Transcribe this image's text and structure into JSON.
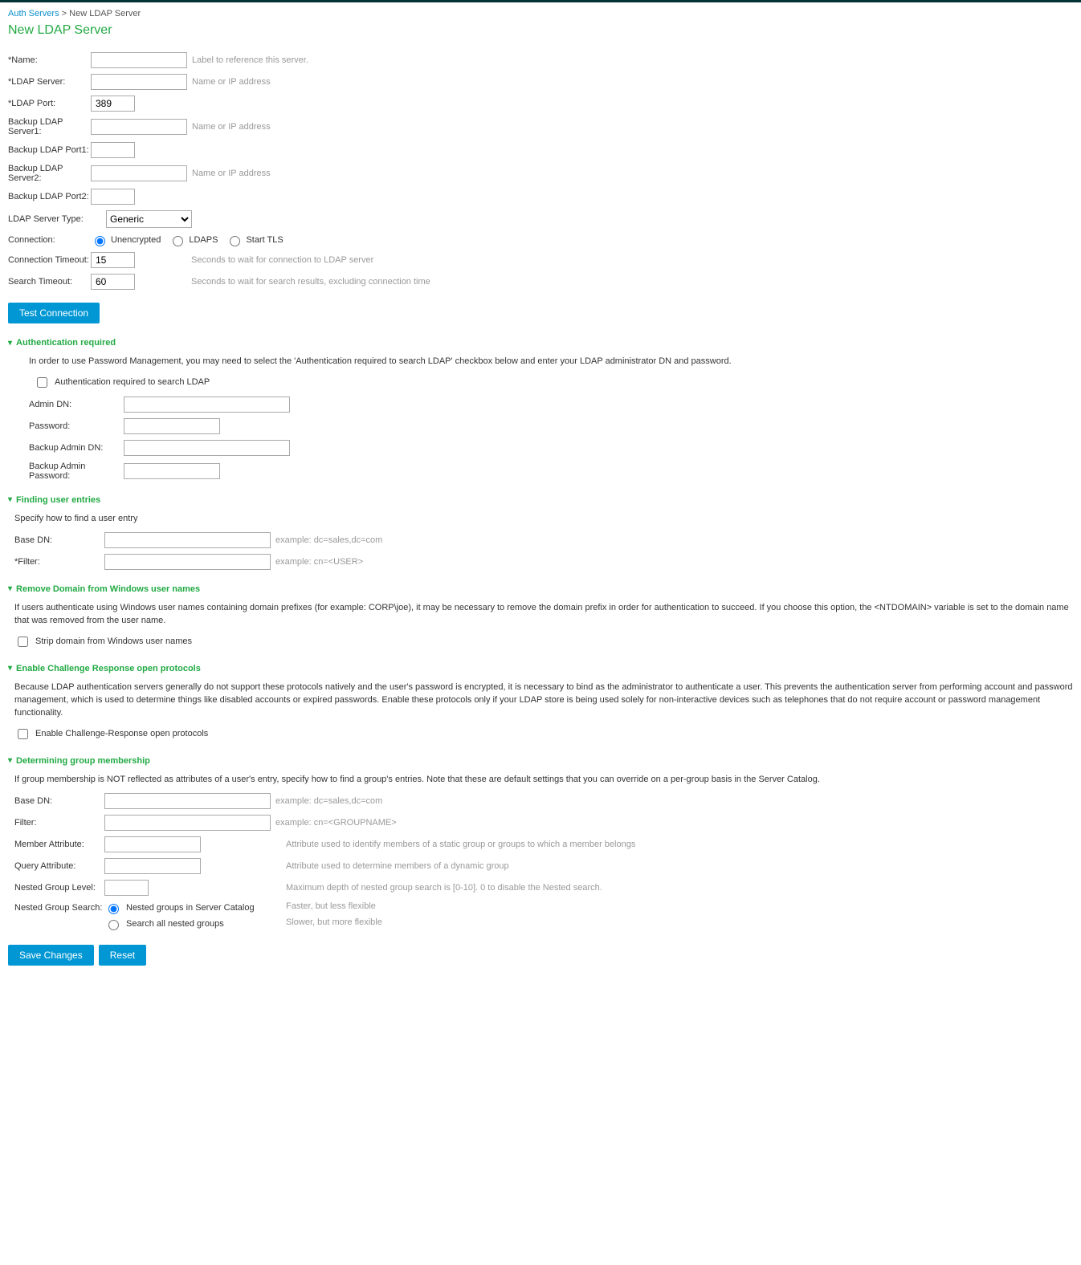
{
  "breadcrumb": {
    "link": "Auth Servers",
    "sep": " > ",
    "current": "New LDAP Server"
  },
  "title": "New LDAP Server",
  "fields": {
    "name_label": "*Name:",
    "name_hint": "Label to reference this server.",
    "server_label": "*LDAP Server:",
    "server_hint": "Name or IP address",
    "port_label": "*LDAP Port:",
    "port_value": "389",
    "bkserver1_label": "Backup LDAP Server1:",
    "bkserver1_hint": "Name or IP address",
    "bkport1_label": "Backup LDAP Port1:",
    "bkserver2_label": "Backup LDAP Server2:",
    "bkserver2_hint": "Name or IP address",
    "bkport2_label": "Backup LDAP Port2:",
    "type_label": "LDAP Server Type:",
    "type_value": "Generic",
    "conn_label": "Connection:",
    "conn_unenc": "Unencrypted",
    "conn_ldaps": "LDAPS",
    "conn_starttls": "Start TLS",
    "conn_timeout_label": "Connection Timeout:",
    "conn_timeout_value": "15",
    "conn_timeout_hint": "Seconds to wait for connection to LDAP server",
    "search_timeout_label": "Search Timeout:",
    "search_timeout_value": "60",
    "search_timeout_hint": "Seconds to wait for search results, excluding connection time",
    "test_btn": "Test Connection"
  },
  "auth": {
    "head": "Authentication required",
    "para": "In order to use Password Management, you may need to select the 'Authentication required to search LDAP' checkbox below and enter your LDAP administrator DN and password.",
    "check_label": "Authentication required to search LDAP",
    "admin_dn": "Admin DN:",
    "password": "Password:",
    "backup_admin_dn": "Backup Admin DN:",
    "backup_admin_pw": "Backup Admin Password:"
  },
  "finding": {
    "head": "Finding user entries",
    "para": "Specify how to find a user entry",
    "base_dn_label": "Base DN:",
    "base_dn_hint": "example: dc=sales,dc=com",
    "filter_label": "*Filter:",
    "filter_hint": "example: cn=<USER>"
  },
  "domain": {
    "head": "Remove Domain from Windows user names",
    "para": "If users authenticate using Windows user names containing domain prefixes (for example: CORP\\joe), it may be necessary to remove the domain prefix in order for authentication to succeed. If you choose this option, the <NTDOMAIN> variable is set to the domain name that was removed from the user name.",
    "check_label": "Strip domain from Windows user names"
  },
  "challenge": {
    "head": "Enable Challenge Response open protocols",
    "para": "Because LDAP authentication servers generally do not support these protocols natively and the user's password is encrypted, it is necessary to bind as the administrator to authenticate a user. This prevents the authentication server from performing account and password management, which is used to determine things like disabled accounts or expired passwords. Enable these protocols only if your LDAP store is being used solely for non-interactive devices such as telephones that do not require account or password management functionality.",
    "check_label": "Enable Challenge-Response open protocols"
  },
  "group": {
    "head": "Determining group membership",
    "para": "If group membership is NOT reflected as attributes of a user's entry, specify how to find a group's entries. Note that these are default settings that you can override on a per-group basis in the Server Catalog.",
    "base_dn_label": "Base DN:",
    "base_dn_hint": "example: dc=sales,dc=com",
    "filter_label": "Filter:",
    "filter_hint": "example: cn=<GROUPNAME>",
    "member_label": "Member Attribute:",
    "member_hint": "Attribute used to identify members of a static group or groups to which a member belongs",
    "query_label": "Query Attribute:",
    "query_hint": "Attribute used to determine members of a dynamic group",
    "level_label": "Nested Group Level:",
    "level_hint": "Maximum depth of nested group search is [0-10]. 0 to disable the Nested search.",
    "search_label": "Nested Group Search:",
    "search_opt1": "Nested groups in Server Catalog",
    "search_hint1": "Faster, but less flexible",
    "search_opt2": "Search all nested groups",
    "search_hint2": "Slower, but more flexible"
  },
  "footer": {
    "save": "Save Changes",
    "reset": "Reset"
  }
}
